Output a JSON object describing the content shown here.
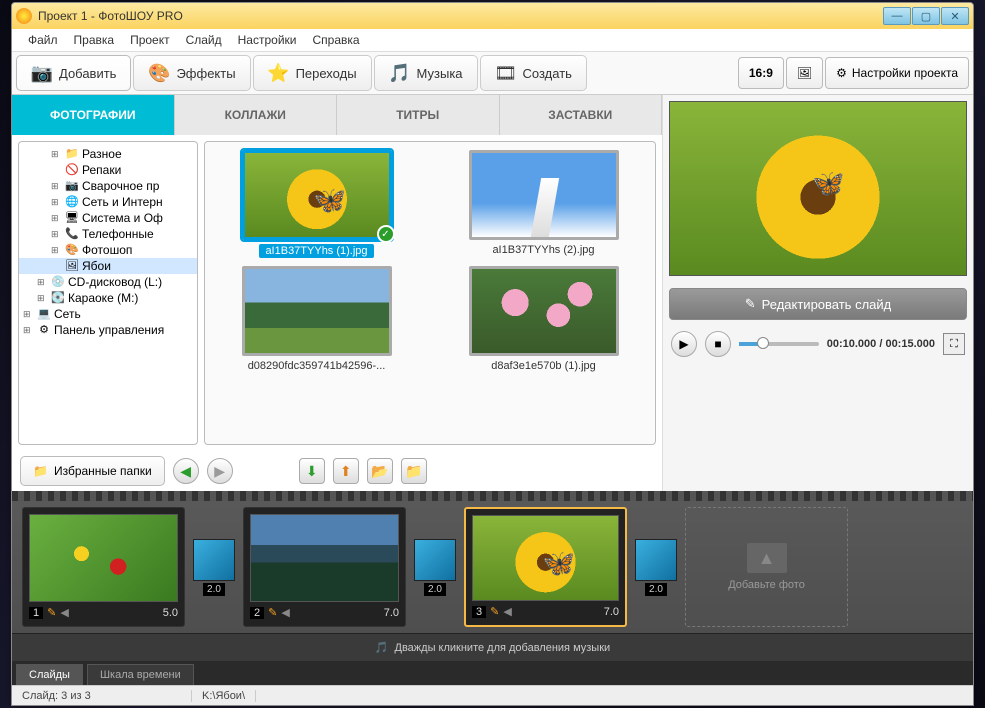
{
  "titlebar": {
    "title": "Проект 1 - ФотоШОУ PRO"
  },
  "menu": {
    "file": "Файл",
    "edit": "Правка",
    "project": "Проект",
    "slide": "Слайд",
    "settings": "Настройки",
    "help": "Справка"
  },
  "toolbar": {
    "add": "Добавить",
    "effects": "Эффекты",
    "transitions": "Переходы",
    "music": "Музыка",
    "create": "Создать",
    "aspect": "16:9",
    "project_settings": "Настройки проекта"
  },
  "subtabs": {
    "photos": "ФОТОГРАФИИ",
    "collages": "КОЛЛАЖИ",
    "titles": "ТИТРЫ",
    "intros": "ЗАСТАВКИ"
  },
  "tree": {
    "items": [
      {
        "indent": 2,
        "exp": "+",
        "icon": "📁",
        "label": "Разное"
      },
      {
        "indent": 2,
        "exp": "",
        "icon": "🚫",
        "label": "Репаки"
      },
      {
        "indent": 2,
        "exp": "+",
        "icon": "📷",
        "label": "Сварочное пр"
      },
      {
        "indent": 2,
        "exp": "+",
        "icon": "🌐",
        "label": "Сеть и Интерн"
      },
      {
        "indent": 2,
        "exp": "+",
        "icon": "🖥",
        "label": "Система и Оф"
      },
      {
        "indent": 2,
        "exp": "+",
        "icon": "📞",
        "label": "Телефонные"
      },
      {
        "indent": 2,
        "exp": "+",
        "icon": "🎨",
        "label": "Фотошоп"
      },
      {
        "indent": 2,
        "exp": "",
        "icon": "🖼",
        "label": "Ябои",
        "selected": true
      },
      {
        "indent": 1,
        "exp": "+",
        "icon": "💿",
        "label": "CD-дисковод (L:)"
      },
      {
        "indent": 1,
        "exp": "+",
        "icon": "💽",
        "label": "Караоке (M:)"
      },
      {
        "indent": 0,
        "exp": "+",
        "icon": "💻",
        "label": "Сеть"
      },
      {
        "indent": 0,
        "exp": "+",
        "icon": "⚙",
        "label": "Панель управления"
      }
    ]
  },
  "thumbs": [
    {
      "caption": "aI1B37TYYhs  (1).jpg",
      "selected": true,
      "cls": "sunflower"
    },
    {
      "caption": "aI1B37TYYhs  (2).jpg",
      "cls": "sky"
    },
    {
      "caption": "d08290fdc359741b42596-...",
      "cls": "landscape"
    },
    {
      "caption": "d8af3e1e570b  (1).jpg",
      "cls": "flowers"
    }
  ],
  "bottom": {
    "favorites": "Избранные папки"
  },
  "preview": {
    "edit_slide": "Редактировать слайд",
    "time": "00:10.000 / 00:15.000"
  },
  "timeline": {
    "slides": [
      {
        "num": "1",
        "dur": "5.0",
        "cls": "leaf"
      },
      {
        "num": "2",
        "dur": "7.0",
        "cls": "mountains"
      },
      {
        "num": "3",
        "dur": "7.0",
        "cls": "sunflower",
        "selected": true
      }
    ],
    "trans_dur": "2.0",
    "add_photo": "Добавьте фото",
    "music_hint": "Дважды кликните для добавления музыки"
  },
  "view_tabs": {
    "slides": "Слайды",
    "timeline": "Шкала времени"
  },
  "status": {
    "slide_count": "Слайд: 3 из 3",
    "path": "K:\\Ябои\\"
  }
}
